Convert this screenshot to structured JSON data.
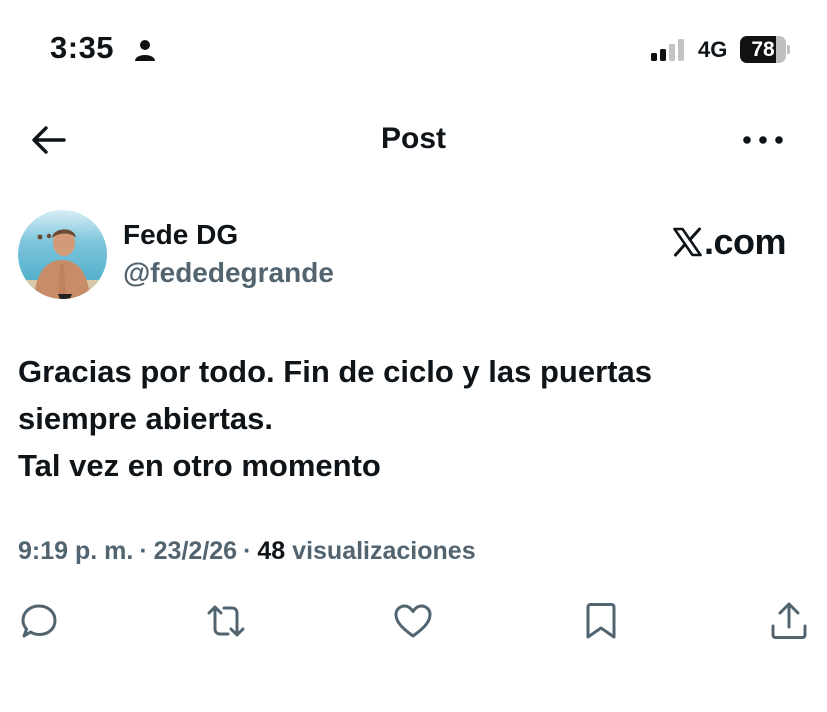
{
  "status_bar": {
    "time": "3:35",
    "network": "4G",
    "battery_percent": 78,
    "battery_label": "78",
    "icons": [
      "person-icon",
      "signal-icon",
      "battery-icon"
    ]
  },
  "nav": {
    "title": "Post",
    "back_icon": "arrow-left-icon",
    "more_icon": "more-horizontal-icon"
  },
  "author": {
    "name": "Fede DG",
    "handle": "@fededegrande"
  },
  "watermark": {
    "text": ".com",
    "icon": "x-logo-icon"
  },
  "post": {
    "lines": [
      "Gracias por todo. Fin de ciclo y las puertas",
      "siempre abiertas.",
      "Tal vez en otro momento"
    ]
  },
  "meta": {
    "time": "9:19 p. m.",
    "separator": "·",
    "date": "23/2/26",
    "views_count": "48",
    "views_label": "visualizaciones"
  },
  "actions": {
    "icons": [
      "reply-icon",
      "repost-icon",
      "like-icon",
      "bookmark-icon",
      "share-icon"
    ]
  },
  "colors": {
    "text": "#0f1419",
    "secondary": "#536471",
    "background": "#ffffff"
  }
}
